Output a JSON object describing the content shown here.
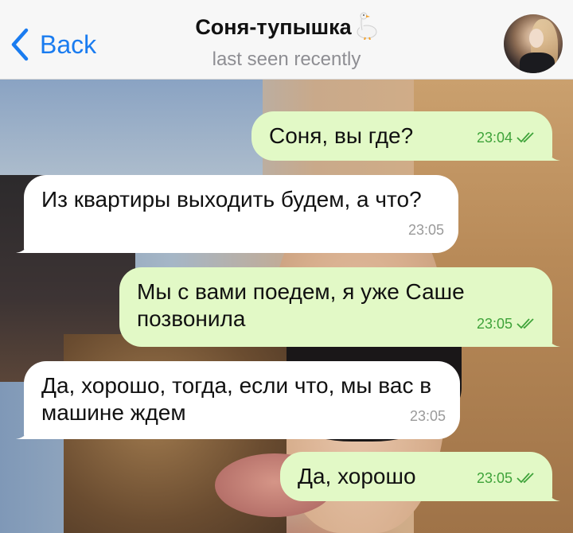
{
  "header": {
    "back_label": "Back",
    "title": "Соня-тупышка",
    "status": "last seen recently"
  },
  "colors": {
    "accent": "#1a7cf0",
    "outgoing_bubble": "#e2f9c6",
    "incoming_bubble": "#ffffff",
    "outgoing_time": "#3fa33a",
    "incoming_time": "#9a9a9a"
  },
  "messages": [
    {
      "direction": "outgoing",
      "text": "Соня, вы где?",
      "time": "23:04",
      "read": true
    },
    {
      "direction": "incoming",
      "text": "Из квартиры выходить будем, а что?",
      "time": "23:05"
    },
    {
      "direction": "outgoing",
      "text": "Мы с вами поедем, я уже Саше позвонила",
      "time": "23:05",
      "read": true
    },
    {
      "direction": "incoming",
      "text": "Да, хорошо, тогда, если что, мы вас в машине ждем",
      "time": "23:05"
    },
    {
      "direction": "outgoing",
      "text": "Да, хорошо",
      "time": "23:05",
      "read": true
    }
  ],
  "icons": {
    "back": "chevron-left-icon",
    "title_emoji": "goose-icon",
    "read_receipt": "double-check-icon"
  }
}
